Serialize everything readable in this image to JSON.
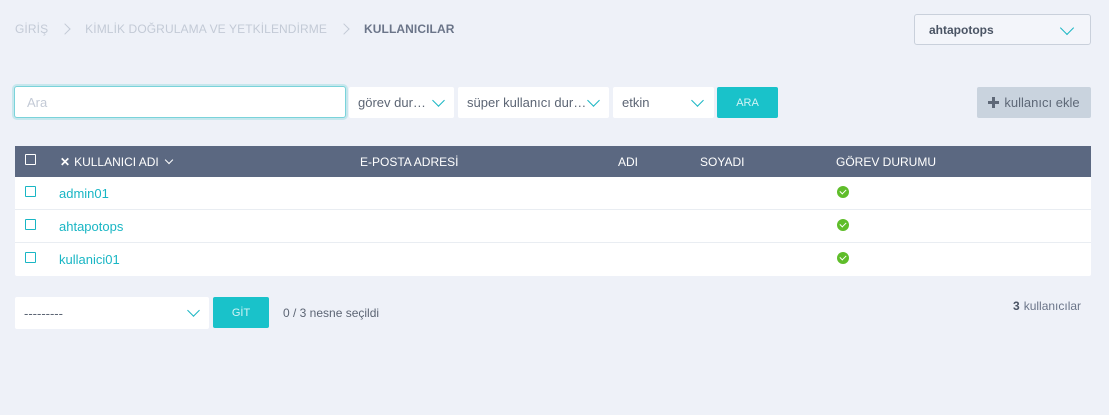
{
  "breadcrumb": {
    "items": [
      "GİRİŞ",
      "KİMLİK DOĞRULAMA VE YETKİLENDİRME"
    ],
    "current": "KULLANICILAR"
  },
  "org_selector": {
    "value": "ahtapotops"
  },
  "toolbar": {
    "search_placeholder": "Ara",
    "filter_task_status": "görev durumu",
    "filter_superuser": "süper kullanıcı durumu",
    "filter_active": "etkin",
    "search_button": "ARA",
    "add_button": "kullanıcı ekle"
  },
  "table": {
    "columns": {
      "username": "KULLANICI ADI",
      "email": "E-POSTA ADRESİ",
      "first_name": "ADI",
      "last_name": "SOYADI",
      "task_status": "GÖREV DURUMU"
    },
    "rows": [
      {
        "username": "admin01",
        "email": "",
        "first_name": "",
        "last_name": "",
        "task_status_icon": "check-circle-icon"
      },
      {
        "username": "ahtapotops",
        "email": "",
        "first_name": "",
        "last_name": "",
        "task_status_icon": "check-circle-icon"
      },
      {
        "username": "kullanici01",
        "email": "",
        "first_name": "",
        "last_name": "",
        "task_status_icon": "check-circle-icon"
      }
    ]
  },
  "footer": {
    "action_select": "---------",
    "go_button": "GİT",
    "selected_count": "0 / 3 nesne seçildi",
    "result_count": "3",
    "result_label": "kullanıcılar"
  },
  "colors": {
    "accent": "#19c2ca",
    "header": "#5b6881",
    "status_ok": "#5fbd2a",
    "background": "#eef1f8"
  }
}
